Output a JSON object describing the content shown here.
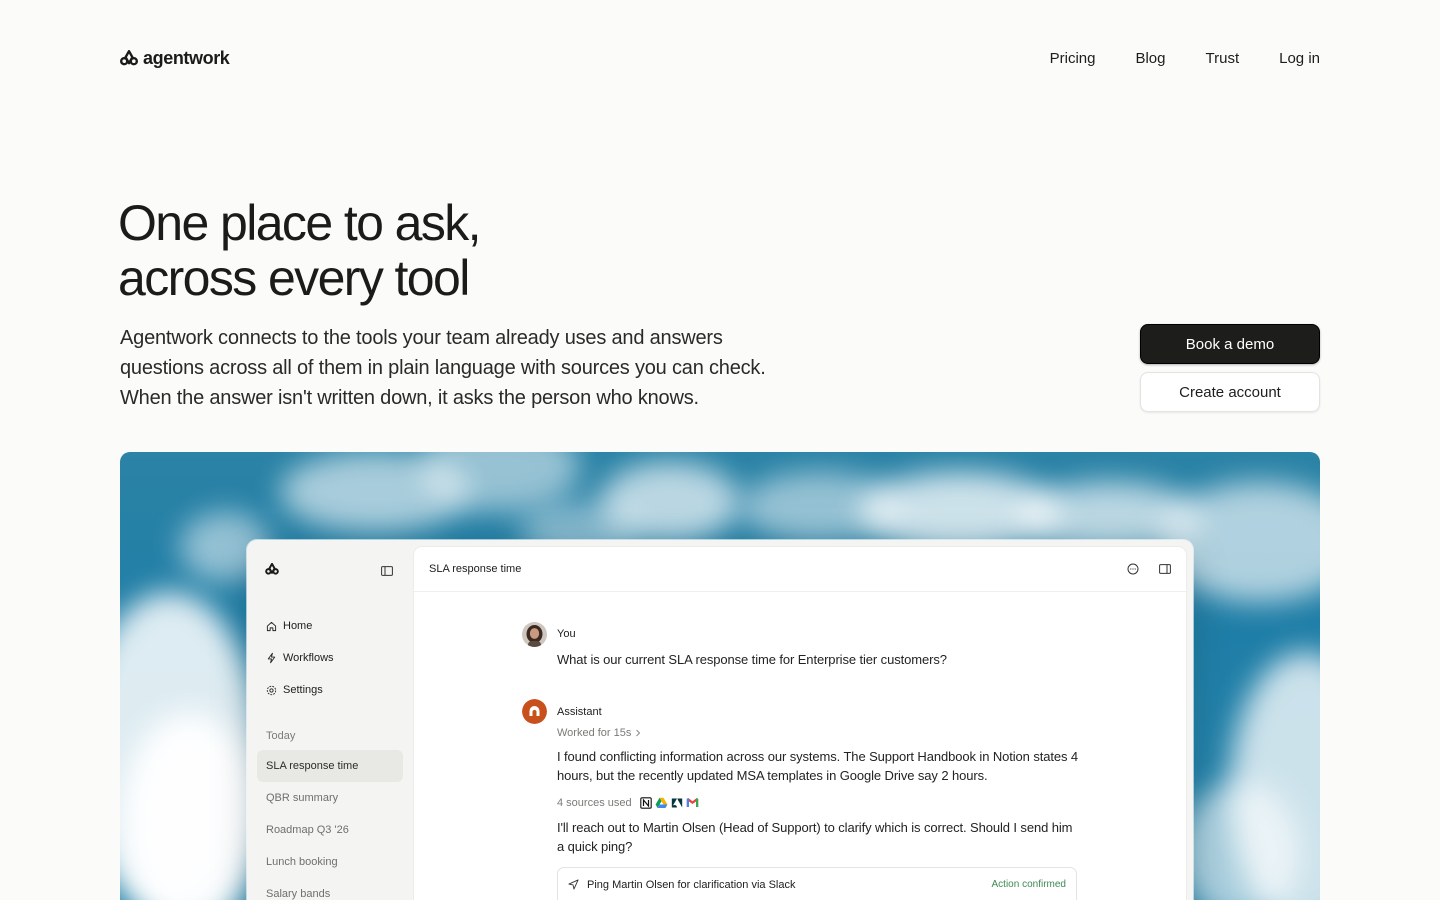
{
  "brand": {
    "name": "agentwork"
  },
  "nav": {
    "links": [
      "Pricing",
      "Blog",
      "Trust",
      "Log in"
    ]
  },
  "hero": {
    "title_lines": [
      "One place to ask,",
      "across every tool"
    ],
    "subtitle_lines": [
      "Agentwork connects to the tools your team already uses and answers",
      "questions across all of them in plain language with sources you can check.",
      "When the answer isn't written down, it asks the person who knows."
    ],
    "primary_cta": "Book a demo",
    "secondary_cta": "Create account"
  },
  "app": {
    "sidebar": {
      "nav": [
        {
          "label": "Home",
          "icon": "home-icon"
        },
        {
          "label": "Workflows",
          "icon": "bolt-icon"
        },
        {
          "label": "Settings",
          "icon": "gear-icon"
        }
      ],
      "section_label": "Today",
      "history": [
        "SLA response time",
        "QBR summary",
        "Roadmap Q3 '26",
        "Lunch booking",
        "Salary bands"
      ],
      "active_history": "SLA response time"
    },
    "header": {
      "title": "SLA response time"
    },
    "chat": {
      "user": {
        "name": "You",
        "text": "What is our current SLA response time for Enterprise tier customers?"
      },
      "assistant": {
        "name": "Assistant",
        "worked": "Worked for 15s",
        "text1": "I found conflicting information across our systems. The Support Handbook in Notion states 4 hours, but the recently updated MSA templates in Google Drive say 2 hours.",
        "sources_label": "4 sources used",
        "source_icons": [
          "notion-icon",
          "google-drive-icon",
          "zendesk-icon",
          "gmail-icon"
        ],
        "text2": "I'll reach out to Martin Olsen (Head of Support) to clarify which is correct. Should I send him a quick ping?",
        "action_label": "Ping Martin Olsen for clarification via Slack",
        "action_status": "Action confirmed"
      }
    }
  },
  "colors": {
    "page_bg": "#fbfbfa",
    "primary_button": "#1d1d1b",
    "sky": "#1f7ea7",
    "success_text": "#3c8a55"
  }
}
